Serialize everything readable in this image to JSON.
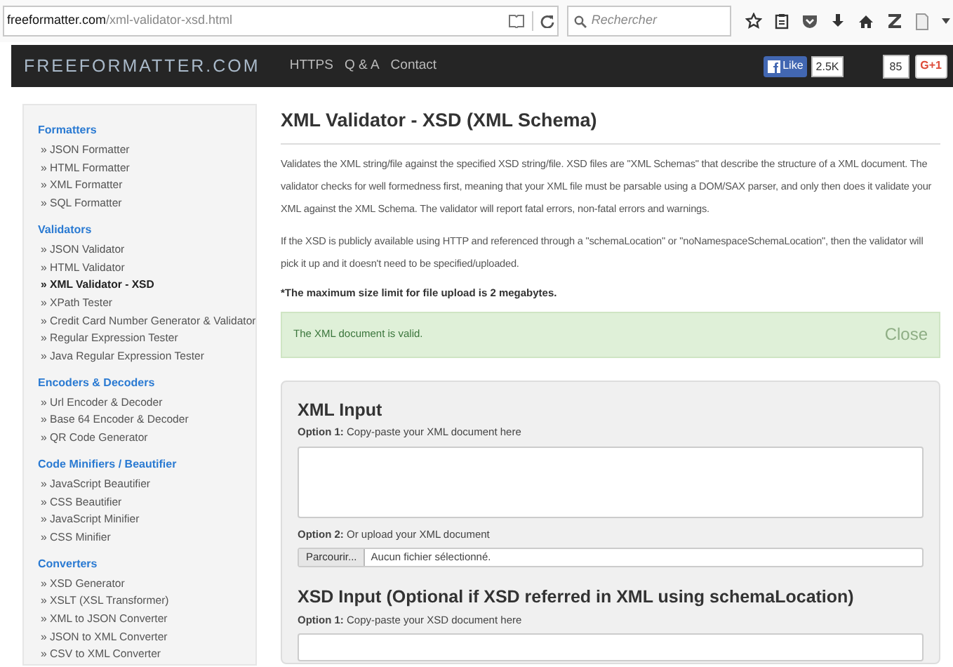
{
  "browser": {
    "url_domain": "freeformatter.com",
    "url_path": "/xml-validator-xsd.html",
    "search_placeholder": "Rechercher"
  },
  "navbar": {
    "logo": "FREEFORMATTER.COM",
    "links": [
      "HTTPS",
      "Q & A",
      "Contact"
    ],
    "like_label": "Like",
    "like_count": "2.5K",
    "plus_count": "85",
    "plus_label": "G+1"
  },
  "sidebar": [
    {
      "heading": "Formatters",
      "items": [
        {
          "label": "» JSON Formatter",
          "selected": false
        },
        {
          "label": "» HTML Formatter",
          "selected": false
        },
        {
          "label": "» XML Formatter",
          "selected": false
        },
        {
          "label": "» SQL Formatter",
          "selected": false
        }
      ]
    },
    {
      "heading": "Validators",
      "items": [
        {
          "label": "» JSON Validator",
          "selected": false
        },
        {
          "label": "» HTML Validator",
          "selected": false
        },
        {
          "label": "» XML Validator - XSD",
          "selected": true
        },
        {
          "label": "» XPath Tester",
          "selected": false
        },
        {
          "label": "» Credit Card Number Generator & Validator",
          "selected": false
        },
        {
          "label": "» Regular Expression Tester",
          "selected": false
        },
        {
          "label": "» Java Regular Expression Tester",
          "selected": false
        }
      ]
    },
    {
      "heading": "Encoders & Decoders",
      "items": [
        {
          "label": "» Url Encoder & Decoder",
          "selected": false
        },
        {
          "label": "» Base 64 Encoder & Decoder",
          "selected": false
        },
        {
          "label": "» QR Code Generator",
          "selected": false
        }
      ]
    },
    {
      "heading": "Code Minifiers / Beautifier",
      "items": [
        {
          "label": "» JavaScript Beautifier",
          "selected": false
        },
        {
          "label": "» CSS Beautifier",
          "selected": false
        },
        {
          "label": "» JavaScript Minifier",
          "selected": false
        },
        {
          "label": "» CSS Minifier",
          "selected": false
        }
      ]
    },
    {
      "heading": "Converters",
      "items": [
        {
          "label": "» XSD Generator",
          "selected": false
        },
        {
          "label": "» XSLT (XSL Transformer)",
          "selected": false
        },
        {
          "label": "» XML to JSON Converter",
          "selected": false
        },
        {
          "label": "» JSON to XML Converter",
          "selected": false
        },
        {
          "label": "» CSV to XML Converter",
          "selected": false
        }
      ]
    }
  ],
  "main": {
    "title": "XML Validator - XSD (XML Schema)",
    "paragraphs": [
      "Validates the XML string/file against the specified XSD string/file. XSD files are \"XML Schemas\" that describe the structure of a XML document. The validator checks for well formedness first, meaning that your XML file must be parsable using a DOM/SAX parser, and only then does it validate your XML against the XML Schema. The validator will report fatal errors, non-fatal errors and warnings.",
      "If the XSD is publicly available using HTTP and referenced through a \"schemaLocation\" or \"noNamespaceSchemaLocation\", then the validator will pick it up and it doesn't need to be specified/uploaded."
    ],
    "note": "*The maximum size limit for file upload is 2 megabytes.",
    "alert": {
      "message": "The XML document is valid.",
      "close": "Close"
    },
    "xml_input": {
      "heading": "XML Input",
      "option1_label": "Option 1:",
      "option1_text": "Copy-paste your XML document here",
      "option2_label": "Option 2:",
      "option2_text": "Or upload your XML document",
      "browse_button": "Parcourir...",
      "file_status": "Aucun fichier sélectionné."
    },
    "xsd_input": {
      "heading": "XSD Input (Optional if XSD referred in XML using schemaLocation)",
      "option1_label": "Option 1:",
      "option1_text": "Copy-paste your XSD document here"
    }
  }
}
